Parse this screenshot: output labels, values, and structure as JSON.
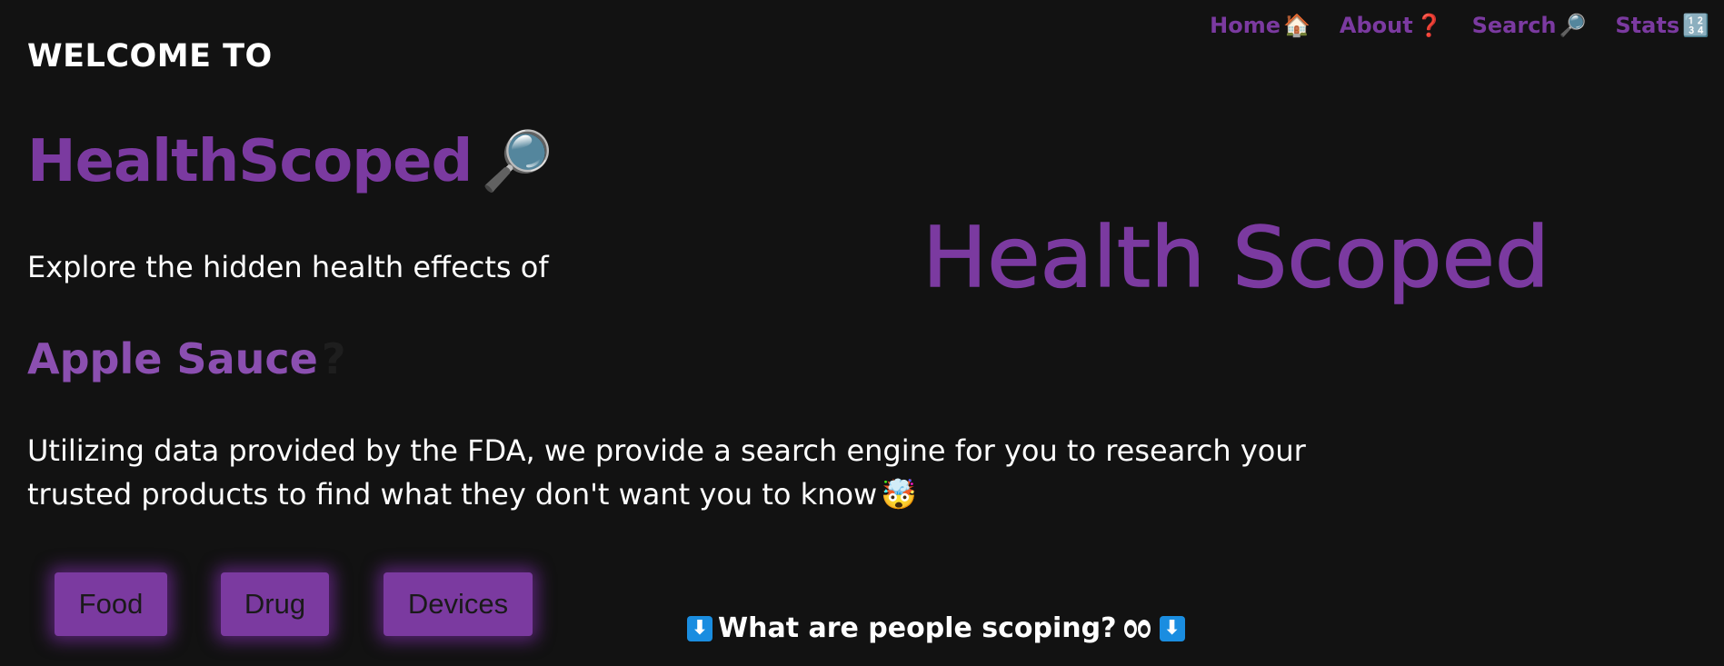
{
  "nav": {
    "items": [
      {
        "label": "Home",
        "icon": "🏠"
      },
      {
        "label": "About",
        "icon": "❓"
      },
      {
        "label": "Search",
        "icon": "🔎"
      },
      {
        "label": "Stats",
        "icon": "🔢"
      }
    ]
  },
  "hero": {
    "welcome": "WELCOME TO",
    "brand": "HealthScoped",
    "brand_icon": "🔎",
    "explore": "Explore the hidden health effects of",
    "product": "Apple Sauce",
    "product_suffix": "?",
    "description": "Utilizing data provided by the FDA, we provide a search engine for you to research your trusted products to find what they don't want you to know",
    "description_emoji": "🤯"
  },
  "categories": {
    "food": "Food",
    "drug": "Drug",
    "devices": "Devices"
  },
  "scoping": {
    "arrow_left": "⬇",
    "text": "What are people scoping?",
    "arrow_right": "⬇"
  },
  "logo": {
    "text": "Health Scoped"
  },
  "colors": {
    "accent": "#7b3aa0",
    "background": "#121212",
    "text": "#ffffff",
    "arrow_box": "#1a8de0"
  }
}
